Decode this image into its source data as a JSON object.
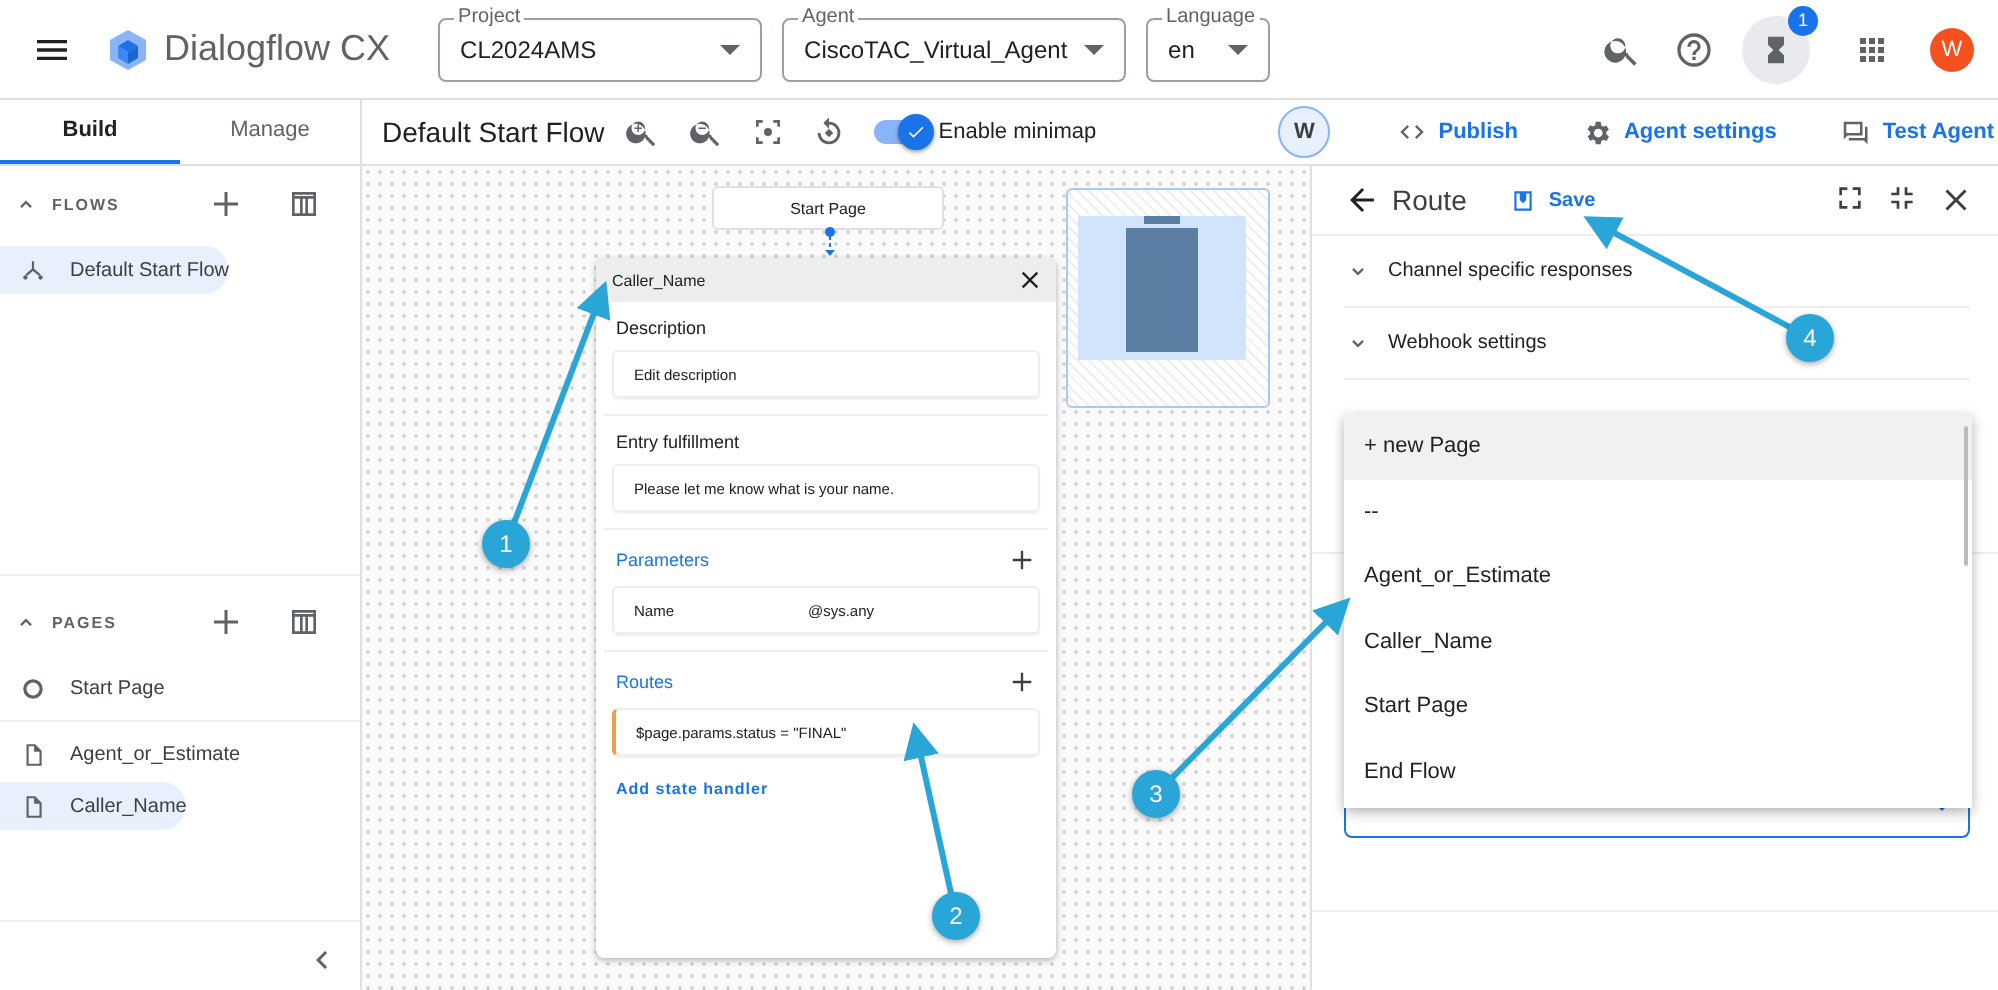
{
  "app": {
    "title": "Dialogflow CX"
  },
  "selectors": [
    {
      "label": "Project",
      "value": "CL2024AMS"
    },
    {
      "label": "Agent",
      "value": "CiscoTAC_Virtual_Agent"
    },
    {
      "label": "Language",
      "value": "en"
    }
  ],
  "notification_badge": "1",
  "avatar": "W",
  "nav_tabs": [
    {
      "label": "Build",
      "selected": true
    },
    {
      "label": "Manage",
      "selected": false
    }
  ],
  "flow_title": "Default Start Flow",
  "minimap_toggle": {
    "label": "Enable minimap",
    "on": true
  },
  "user_chip": "W",
  "actions": [
    {
      "kind": "publish",
      "label": "Publish"
    },
    {
      "kind": "settings",
      "label": "Agent settings"
    },
    {
      "kind": "test",
      "label": "Test Agent"
    }
  ],
  "sidebar": {
    "sections": [
      {
        "title": "FLOWS",
        "expanded": true,
        "items": [
          {
            "kind": "flow",
            "label": "Default Start Flow",
            "selected": true
          }
        ]
      },
      {
        "title": "PAGES",
        "expanded": true,
        "items": [
          {
            "kind": "start",
            "label": "Start Page",
            "selected": false
          },
          {
            "kind": "page",
            "label": "Agent_or_Estimate",
            "selected": false
          },
          {
            "kind": "page",
            "label": "Caller_Name",
            "selected": true
          }
        ]
      }
    ]
  },
  "canvas": {
    "start_node": "Start Page",
    "page_card": {
      "title": "Caller_Name",
      "description": {
        "label": "Description",
        "value": "Edit description"
      },
      "entry_fulfillment": {
        "label": "Entry fulfillment",
        "value": "Please let me know what is your name."
      },
      "parameters": {
        "label": "Parameters",
        "rows": [
          {
            "name": "Name",
            "type": "@sys.any"
          }
        ]
      },
      "routes": {
        "label": "Routes",
        "rows": [
          {
            "condition": "$page.params.status = \"FINAL\""
          }
        ]
      },
      "add_handler": "Add state handler"
    }
  },
  "route_panel": {
    "title": "Route",
    "save": "Save",
    "sections": [
      {
        "label": "Channel specific responses",
        "expanded": false
      },
      {
        "label": "Webhook settings",
        "expanded": false
      }
    ],
    "page_menu": [
      {
        "label": "+ new Page",
        "selected": true
      },
      {
        "label": "--",
        "selected": false
      },
      {
        "label": "Agent_or_Estimate",
        "selected": false
      },
      {
        "label": "Caller_Name",
        "selected": false
      },
      {
        "label": "Start Page",
        "selected": false
      },
      {
        "label": "End Flow",
        "selected": false
      }
    ]
  },
  "callouts": [
    {
      "label": "1"
    },
    {
      "label": "2"
    },
    {
      "label": "3"
    },
    {
      "label": "4"
    }
  ]
}
